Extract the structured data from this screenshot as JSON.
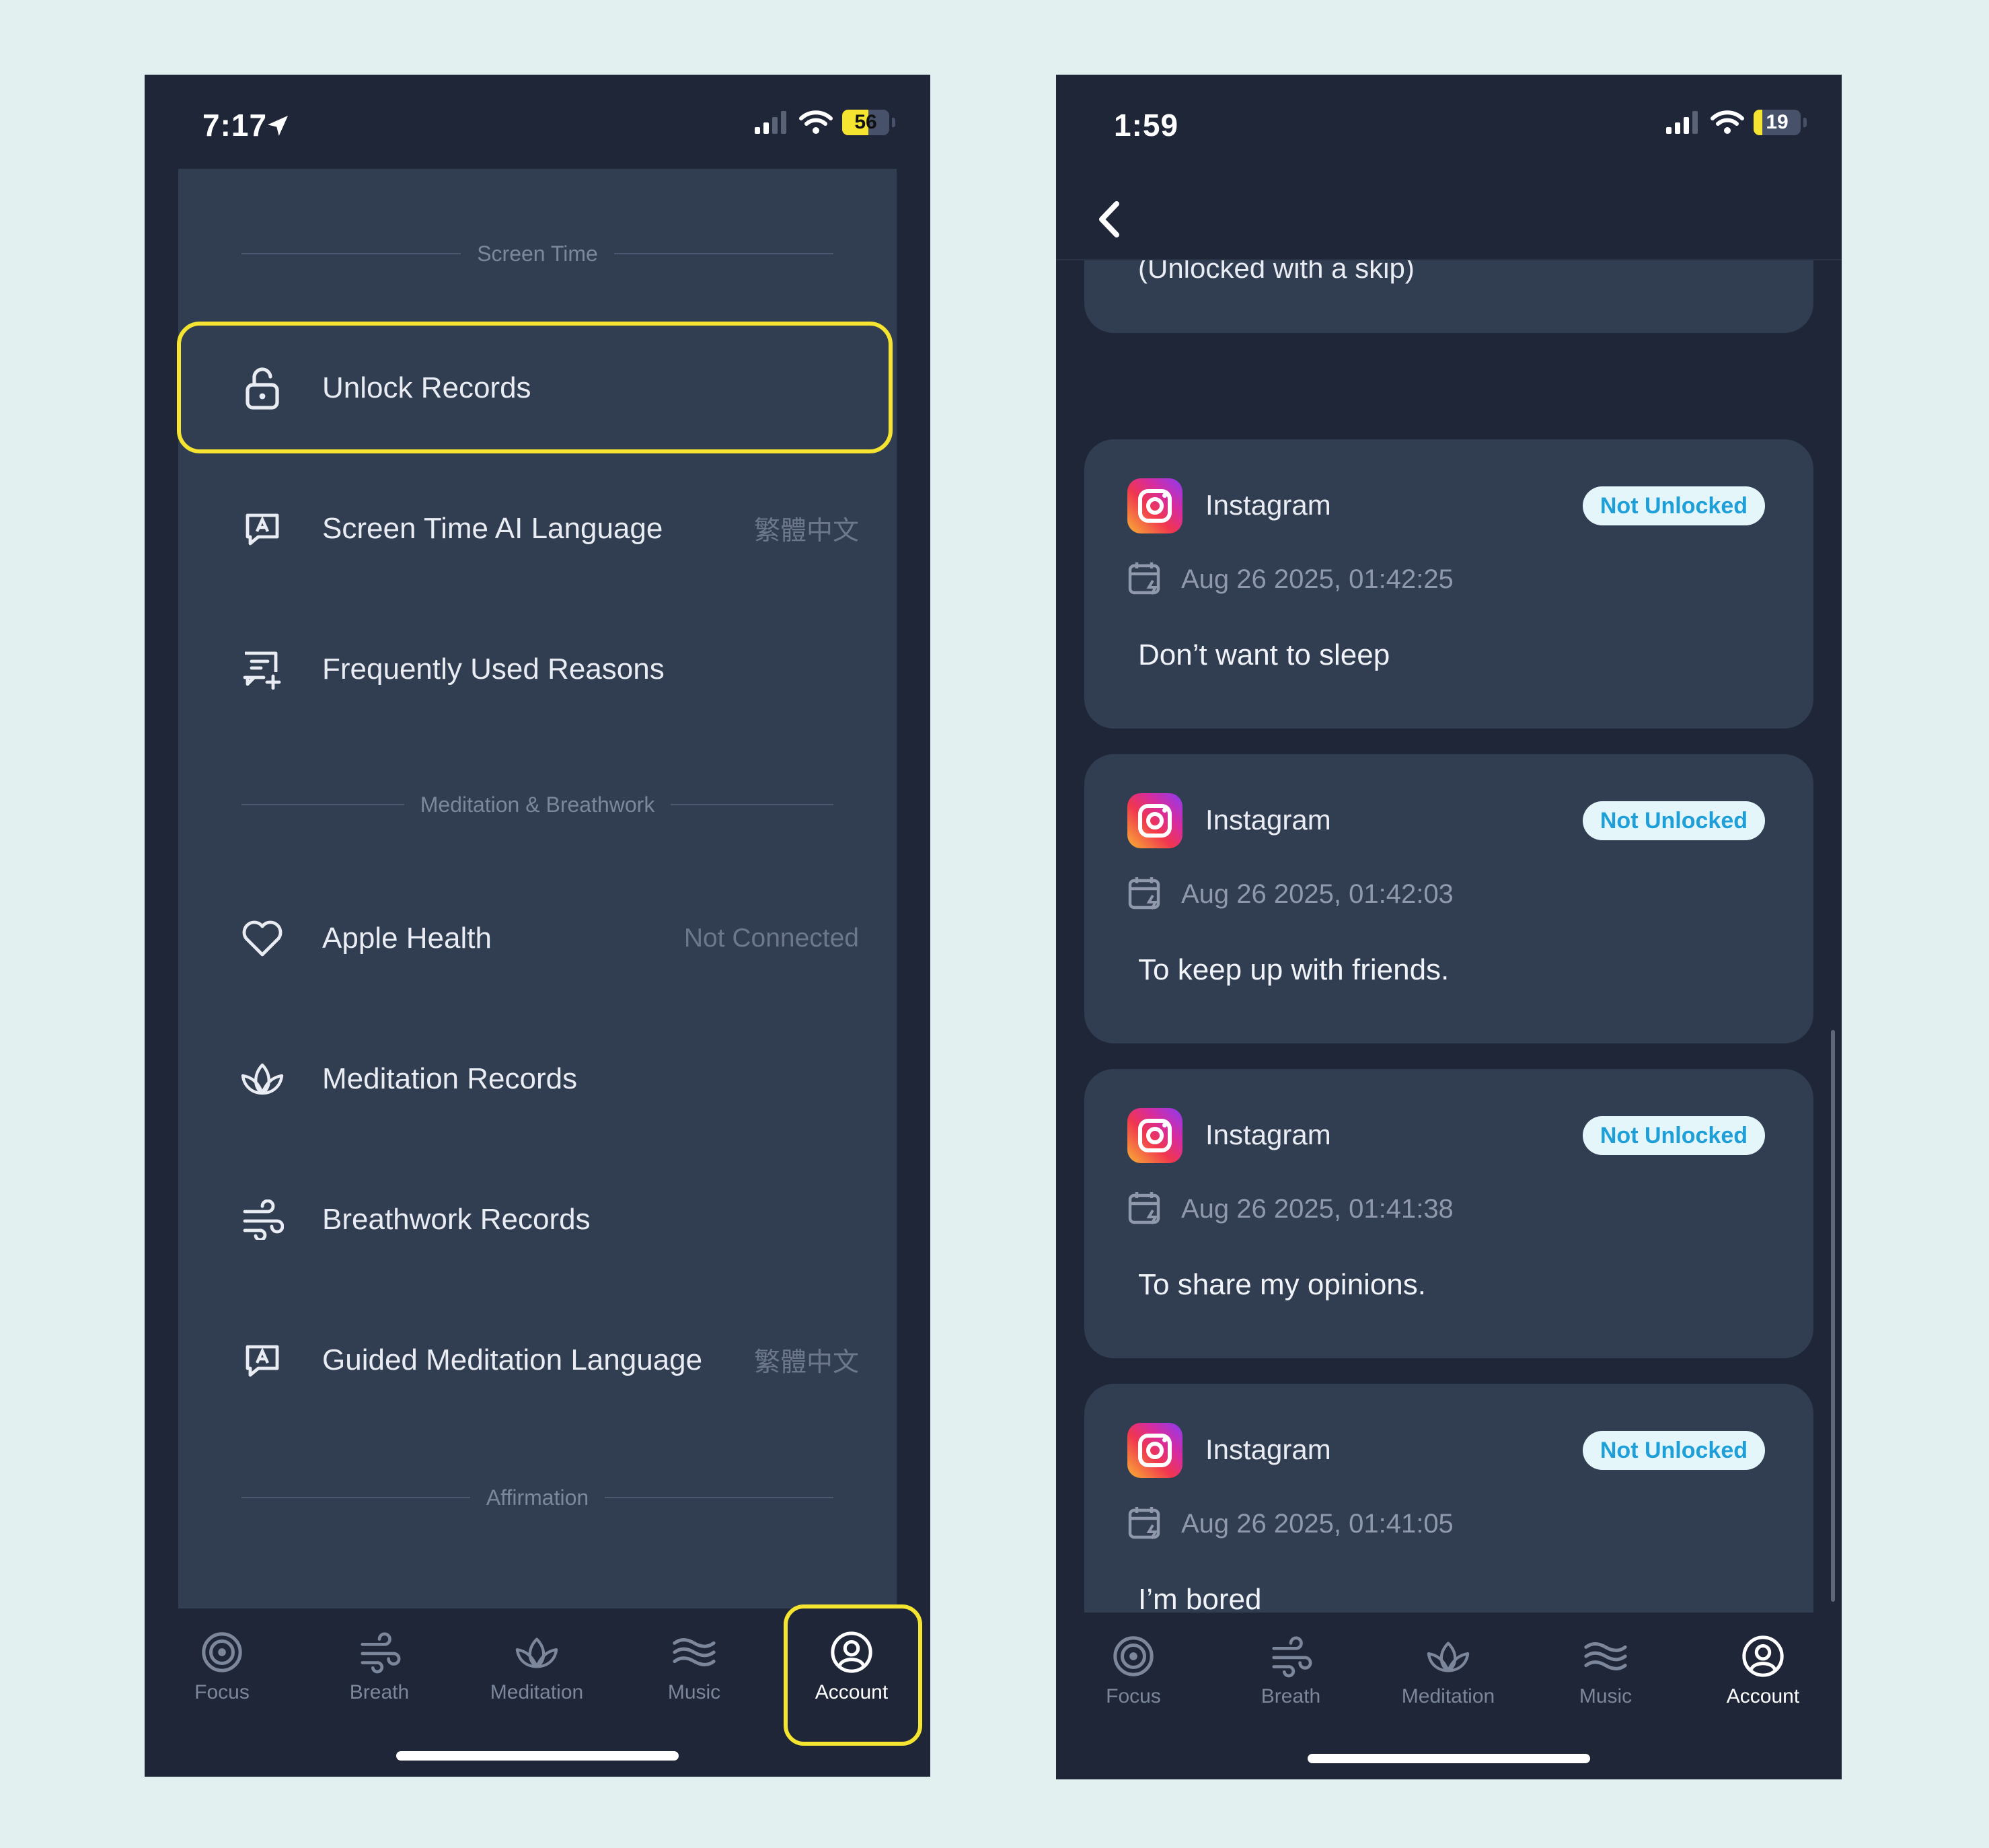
{
  "left_screen": {
    "status_bar": {
      "time": "7:17",
      "battery": "56",
      "battery_color": "#f5e530"
    },
    "sections": [
      {
        "title": "Screen Time"
      },
      {
        "title": "Meditation & Breathwork"
      },
      {
        "title": "Affirmation"
      }
    ],
    "rows": [
      {
        "label": "Unlock Records",
        "value": "",
        "icon": "lock-open-icon"
      },
      {
        "label": "Screen Time AI Language",
        "value": "繁體中文",
        "icon": "language-icon"
      },
      {
        "label": "Frequently Used Reasons",
        "value": "",
        "icon": "message-plus-icon"
      },
      {
        "label": "Apple Health",
        "value": "Not Connected",
        "icon": "heart-icon"
      },
      {
        "label": "Meditation Records",
        "value": "",
        "icon": "lotus-icon"
      },
      {
        "label": "Breathwork Records",
        "value": "",
        "icon": "wind-icon"
      },
      {
        "label": "Guided Meditation Language",
        "value": "繁體中文",
        "icon": "language-icon"
      }
    ]
  },
  "right_screen": {
    "status_bar": {
      "time": "1:59",
      "battery": "19",
      "battery_color": "#f5e530"
    },
    "top_card_text": "(Unlocked with a skip)",
    "records": [
      {
        "app": "Instagram",
        "status": "Not Unlocked",
        "time": "Aug 26 2025, 01:42:25",
        "reason": "Don’t want to sleep"
      },
      {
        "app": "Instagram",
        "status": "Not Unlocked",
        "time": "Aug 26 2025, 01:42:03",
        "reason": "To keep up with friends."
      },
      {
        "app": "Instagram",
        "status": "Not Unlocked",
        "time": "Aug 26 2025, 01:41:38",
        "reason": "To share my opinions."
      },
      {
        "app": "Instagram",
        "status": "Not Unlocked",
        "time": "Aug 26 2025, 01:41:05",
        "reason": "I’m bored"
      }
    ]
  },
  "tabs": [
    {
      "label": "Focus",
      "icon": "target-icon"
    },
    {
      "label": "Breath",
      "icon": "wind-icon"
    },
    {
      "label": "Meditation",
      "icon": "lotus-icon"
    },
    {
      "label": "Music",
      "icon": "waves-icon"
    },
    {
      "label": "Account",
      "icon": "account-icon"
    }
  ],
  "active_tab": "Account",
  "colors": {
    "highlight": "#f5e530",
    "background": "#e2f1ef",
    "panel": "#313d51",
    "phone": "#1e2638",
    "badge_text": "#1e9fd8"
  }
}
